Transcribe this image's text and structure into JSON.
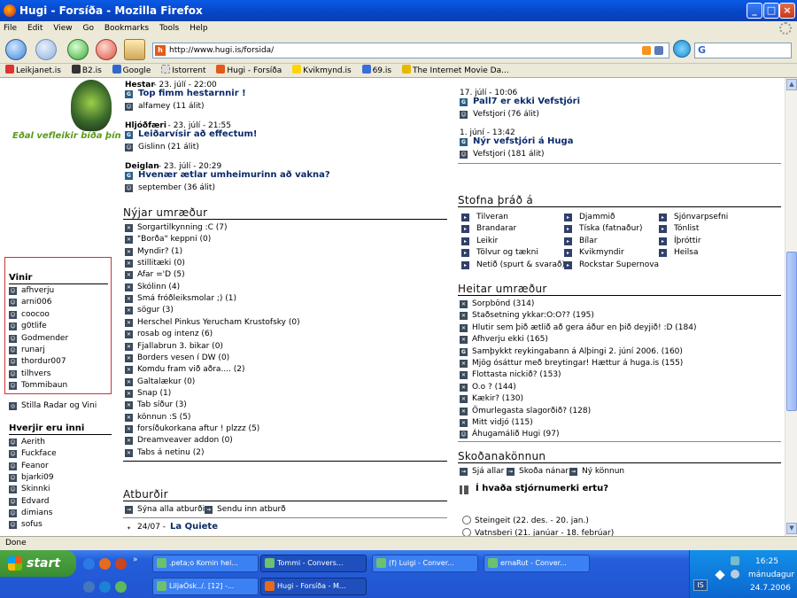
{
  "window": {
    "title": "Hugi - Forsíða - Mozilla Firefox"
  },
  "menu": [
    "File",
    "Edit",
    "View",
    "Go",
    "Bookmarks",
    "Tools",
    "Help"
  ],
  "url": "http://www.hugi.is/forsida/",
  "bookmarks": [
    "Leikjanet.is",
    "B2.is",
    "Google",
    "Istorrent",
    "Hugi - Forsíða",
    "Kvikmynd.is",
    "69.is",
    "The Internet Movie Da..."
  ],
  "status": "Done",
  "left": {
    "banner": "Eðal vefleikir bíða þín",
    "vinir_title": "Vinir",
    "vinir": [
      "afhverju",
      "arni006",
      "coocoo",
      "g0tlife",
      "Godmender",
      "runarj",
      "thordur007",
      "tilhvers",
      "Tommibaun"
    ],
    "stilla": "Stilla Radar og Vini",
    "hverjir_title": "Hverjir eru inni",
    "hverjir": [
      "Aerith",
      "Fuckface",
      "Feanor",
      "bjarki09",
      "Skinnki",
      "Edvard",
      "dimians",
      "sofus"
    ]
  },
  "newest": [
    {
      "cat": "Hestar",
      "date": " - 23. júlí - 22:00",
      "title": "Top fimm hestarnnir !",
      "author": "alfamey (11 álit)"
    },
    {
      "cat": "Hljóðfæri",
      "date": " - 23. júlí - 21:55",
      "title": "Leiðarvísir að effectum!",
      "author": "Gislinn (21 álit)"
    },
    {
      "cat": "Deiglan",
      "date": " - 23. júlí - 20:29",
      "title": "Hvenær ætlar umheimurinn að vakna?",
      "author": "september (36 álit)"
    }
  ],
  "nyjar_title": "Nýjar umræður",
  "nyjar": [
    "Sorgartilkynning :C (7)",
    "\"Borða\" keppni (0)",
    "Myndir? (1)",
    "stillitæki (0)",
    "Afar ='D (5)",
    "Skólinn (4)",
    "Smá fróðleiksmolar ;) (1)",
    "sögur (3)",
    "Herschel Pinkus Yerucham Krustofsky (0)",
    "rosab og intenz (6)",
    "Fjallabrun 3. bikar (0)",
    "Borders vesen í DW (0)",
    "Komdu fram við aðra.... (2)",
    "Galtalækur (0)",
    "Snap (1)",
    "Tab síður (3)",
    "könnun :S (5)",
    "forsíðukorkana aftur ! plzzz (5)",
    "Dreamveaver addon (0)",
    "Tabs á netinu (2)"
  ],
  "atburdir_title": "Atburðir",
  "atburdir_links": [
    "Sýna alla atburði",
    "Sendu inn atburð"
  ],
  "atburdir_item": {
    "date": "24/07 - ",
    "title": "La Quiete"
  },
  "right_news": [
    {
      "date": "17. júlí - 10:06",
      "title": "Pall7 er ekki Vefstjóri",
      "author": "Vefstjori (76 álit)"
    },
    {
      "date": "1. júní - 13:42",
      "title": "Nýr vefstjóri á Huga",
      "author": "Vefstjori (181 álit)"
    }
  ],
  "stofna_title": "Stofna þráð á",
  "stofna": [
    [
      "Tilveran",
      "Djammið",
      "Sjónvarpsefni"
    ],
    [
      "Brandarar",
      "Tíska (fatnaður)",
      "Tónlist"
    ],
    [
      "Leikir",
      "Bílar",
      "Íþróttir"
    ],
    [
      "Tölvur og tækni",
      "Kvikmyndir",
      "Heilsa"
    ],
    [
      "Netið (spurt & svarað)",
      "Rockstar Supernova",
      ""
    ]
  ],
  "heitar_title": "Heitar umræður",
  "heitar": [
    "Sorpbönd (314)",
    "Staðsetning ykkar:O:O?? (195)",
    "Hlutir sem þið ætlið að gera áður en þið deyjið! :D (184)",
    "Afhverju ekki (165)",
    "Samþykkt reykingabann á Alþingi 2. júní 2006. (160)",
    "Mjög ósáttur með breytingar! Hættur á huga.is (155)",
    "Flottasta nickið? (153)",
    "O.o ? (144)",
    "Kækir? (130)",
    "Ömurlegasta slagorðið? (128)",
    "Mitt vidjó (115)",
    "Áhugamálið Hugi (97)"
  ],
  "skodana_title": "Skoðanakönnun",
  "skodana_links": [
    "Sjá allar",
    "Skoða nánar",
    "Ný könnun"
  ],
  "poll_question": "Í hvaða stjórnumerki ertu?",
  "poll_options": [
    "Steingeit (22. des. - 20. jan.)",
    "Vatnsberi (21. janúar - 18. febrúar)"
  ],
  "taskbar": {
    "start": "start",
    "row1": [
      ".peta;o Komin hei...",
      "Tommi - Convers...",
      "(f) Luigi - Conver...",
      "ernaRut - Conver..."
    ],
    "row2": [
      "LiljaÓsk../. [12] -...",
      "Hugi - Forsíða - M..."
    ],
    "lang": "IS",
    "time": "16:25",
    "day": "mánudagur",
    "date": "24.7.2006"
  }
}
